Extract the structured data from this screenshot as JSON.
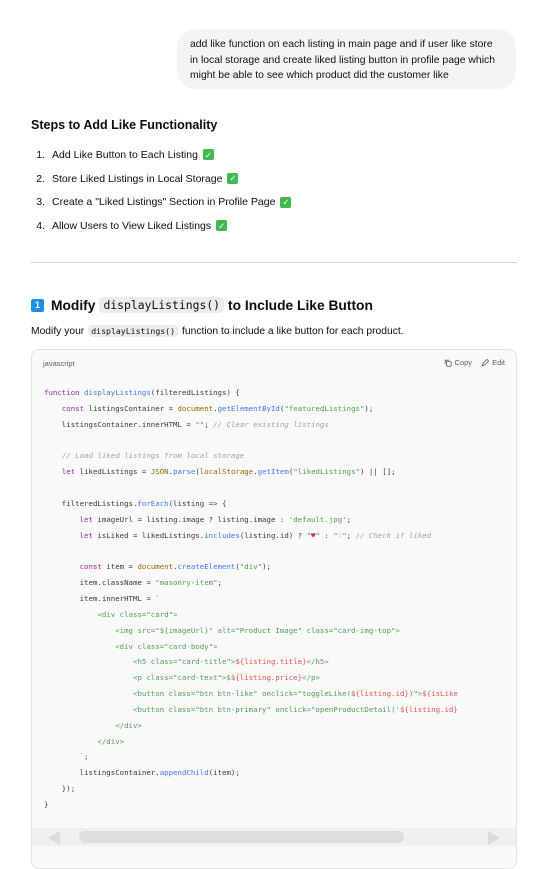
{
  "user_message": {
    "lines": [
      "add like function on each listing in main page and if user like store",
      "in local storage and create liked listing button in profile page which",
      "might be able to see which product did the customer like"
    ]
  },
  "steps": {
    "heading": "Steps to Add Like Functionality",
    "items": [
      {
        "num": "1.",
        "text": "Add Like Button to Each Listing"
      },
      {
        "num": "2.",
        "text": "Store Liked Listings in Local Storage"
      },
      {
        "num": "3.",
        "text": "Create a \"Liked Listings\" Section in Profile Page"
      },
      {
        "num": "4.",
        "text": "Allow Users to View Liked Listings"
      }
    ],
    "check_glyph": "✓",
    "check_color": "#3fb950"
  },
  "section": {
    "keycap": "1",
    "heading_before": "Modify",
    "heading_code": "displayListings()",
    "heading_after": "to Include Like Button",
    "intro_before": "Modify your",
    "intro_code": "displayListings()",
    "intro_after": "function to include a like button for each product."
  },
  "code_block": {
    "language": "javascript",
    "copy_label": "Copy",
    "edit_label": "Edit",
    "copy_icon": "copy-icon",
    "edit_icon": "pencil-icon",
    "lines": [
      [
        [
          "kw",
          "function "
        ],
        [
          "fn",
          "displayListings"
        ],
        [
          "",
          "(filteredListings) {"
        ]
      ],
      [
        [
          "",
          "    "
        ],
        [
          "kw",
          "const "
        ],
        [
          "",
          "listingsContainer = "
        ],
        [
          "at",
          "document"
        ],
        [
          "",
          "."
        ],
        [
          "fn",
          "getElementById"
        ],
        [
          "",
          "("
        ],
        [
          "str",
          "\"featuredListings\""
        ],
        [
          "",
          ");"
        ]
      ],
      [
        [
          "",
          "    listingsContainer.innerHTML = "
        ],
        [
          "str",
          "\"\""
        ],
        [
          "",
          "; "
        ],
        [
          "cm",
          "// Clear existing listings"
        ]
      ],
      [
        [
          "",
          ""
        ]
      ],
      [
        [
          "",
          "    "
        ],
        [
          "cm",
          "// Load liked listings from local storage"
        ]
      ],
      [
        [
          "",
          "    "
        ],
        [
          "kw",
          "let "
        ],
        [
          "",
          "likedListings = "
        ],
        [
          "at",
          "JSON"
        ],
        [
          "",
          "."
        ],
        [
          "fn",
          "parse"
        ],
        [
          "",
          "("
        ],
        [
          "at",
          "localStorage"
        ],
        [
          "",
          "."
        ],
        [
          "fn",
          "getItem"
        ],
        [
          "",
          "("
        ],
        [
          "str",
          "\"likedListings\""
        ],
        [
          "",
          ") || [];"
        ]
      ],
      [
        [
          "",
          ""
        ]
      ],
      [
        [
          "",
          "    filteredListings."
        ],
        [
          "fn",
          "forEach"
        ],
        [
          "",
          "(listing => {"
        ]
      ],
      [
        [
          "",
          "        "
        ],
        [
          "kw",
          "let "
        ],
        [
          "",
          "imageUrl = listing.image ? listing.image : "
        ],
        [
          "str",
          "'default.jpg'"
        ],
        [
          "",
          ";"
        ]
      ],
      [
        [
          "",
          "        "
        ],
        [
          "kw",
          "let "
        ],
        [
          "",
          "isLiked = likedListings."
        ],
        [
          "fn",
          "includes"
        ],
        [
          "",
          "(listing.id) ? "
        ],
        [
          "str",
          "\""
        ],
        [
          "hb",
          "♥"
        ],
        [
          "str",
          "\""
        ],
        [
          "",
          " : "
        ],
        [
          "str",
          "\"♡\""
        ],
        [
          "",
          "; "
        ],
        [
          "cm",
          "// Check if liked"
        ]
      ],
      [
        [
          "",
          ""
        ]
      ],
      [
        [
          "",
          "        "
        ],
        [
          "kw",
          "const "
        ],
        [
          "",
          "item = "
        ],
        [
          "at",
          "document"
        ],
        [
          "",
          "."
        ],
        [
          "fn",
          "createElement"
        ],
        [
          "",
          "("
        ],
        [
          "str",
          "\"div\""
        ],
        [
          "",
          ");"
        ]
      ],
      [
        [
          "",
          "        item.className = "
        ],
        [
          "str",
          "\"masonry-item\""
        ],
        [
          "",
          ";"
        ]
      ],
      [
        [
          "",
          "        item.innerHTML = "
        ],
        [
          "str",
          "`"
        ]
      ],
      [
        [
          "str",
          "            <div class=\"card\">"
        ]
      ],
      [
        [
          "str",
          "                <img src=\"${imageUrl}\" alt=\"Product Image\" class=\"card-img-top\">"
        ]
      ],
      [
        [
          "str",
          "                <div class=\"card-body\">"
        ]
      ],
      [
        [
          "str",
          "                    <h5 class=\"card-title\">"
        ],
        [
          "tag",
          "${listing.title}"
        ],
        [
          "str",
          "</h5>"
        ]
      ],
      [
        [
          "str",
          "                    <p class=\"card-text\">$"
        ],
        [
          "tag",
          "${listing.price}"
        ],
        [
          "str",
          "</p>"
        ]
      ],
      [
        [
          "str",
          "                    <button class=\"btn btn-like\" onclick=\"toggleLike("
        ],
        [
          "tag",
          "${listing.id}"
        ],
        [
          "str",
          ")\">"
        ],
        [
          "tag",
          "${isLike"
        ]
      ],
      [
        [
          "str",
          "                    <button class=\"btn btn-primary\" onclick=\"openProductDetail('"
        ],
        [
          "tag",
          "${listing.id}"
        ]
      ],
      [
        [
          "str",
          "                </div>"
        ]
      ],
      [
        [
          "str",
          "            </div>"
        ]
      ],
      [
        [
          "str",
          "        `"
        ],
        [
          "",
          ";"
        ]
      ],
      [
        [
          "",
          "        listingsContainer."
        ],
        [
          "fn",
          "appendChild"
        ],
        [
          "",
          "(item);"
        ]
      ],
      [
        [
          "",
          "    });"
        ]
      ],
      [
        [
          "",
          "}"
        ]
      ]
    ]
  }
}
